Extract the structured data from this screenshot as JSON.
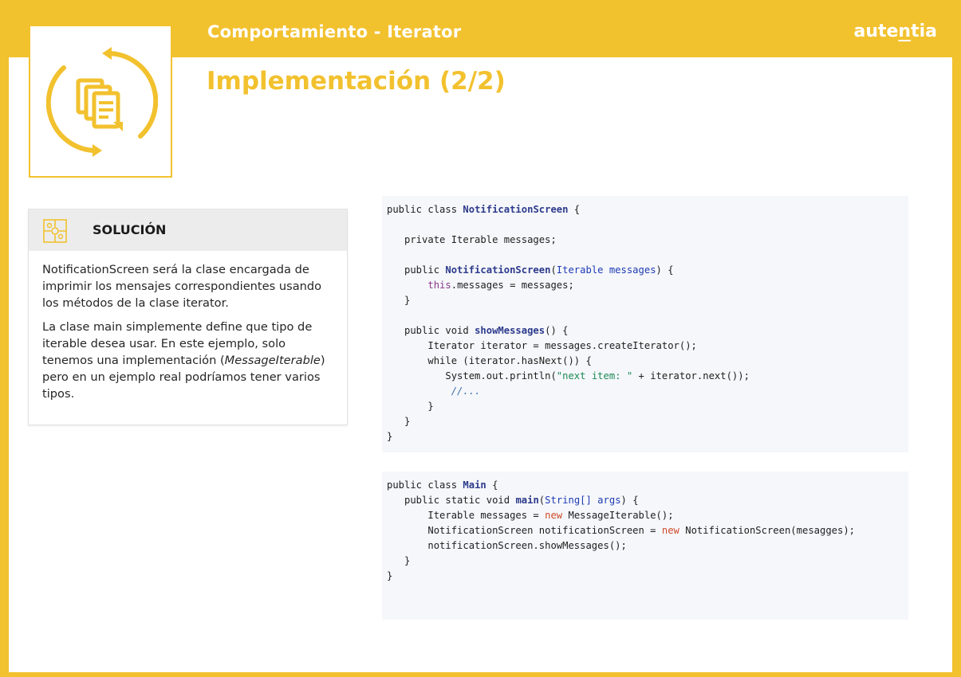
{
  "header": {
    "section_title": "Comportamiento - Iterator",
    "brand": "autentia",
    "page_title": "Implementación (2/2)"
  },
  "icons": {
    "logo": "iterator-cycle-documents-icon",
    "card": "puzzle-icon"
  },
  "colors": {
    "accent": "#F2C12E",
    "card_header_bg": "#ececec",
    "code_bg": "#f5f7fa"
  },
  "solution": {
    "heading": "SOLUCIÓN",
    "para1": "NotificationScreen será la clase encargada de imprimir los mensajes correspondientes usando los métodos de la clase iterator.",
    "para2_before": "La clase main simplemente define que tipo de iterable desea usar. En este ejemplo, solo tenemos una implementación (",
    "para2_italic": "MessageIterable",
    "para2_after": ") pero en un ejemplo real podríamos tener varios tipos."
  },
  "code_blocks": [
    {
      "name": "notification-screen",
      "lines": [
        "public class NotificationScreen {",
        "",
        "   private Iterable messages;",
        "",
        "   public NotificationScreen(Iterable messages) {",
        "       this.messages = messages;",
        "   }",
        "",
        "   public void showMessages() {",
        "       Iterator iterator = messages.createIterator();",
        "       while (iterator.hasNext()) {",
        "          System.out.println(\"next item: \" + iterator.next());",
        "           //...",
        "       }",
        "   }",
        "}"
      ]
    },
    {
      "name": "main",
      "lines": [
        "public class Main {",
        "   public static void main(String[] args) {",
        "       Iterable messages = new MessageIterable();",
        "       NotificationScreen notificationScreen = new NotificationScreen(mesagges);",
        "       notificationScreen.showMessages();",
        "   }",
        "}"
      ]
    }
  ]
}
